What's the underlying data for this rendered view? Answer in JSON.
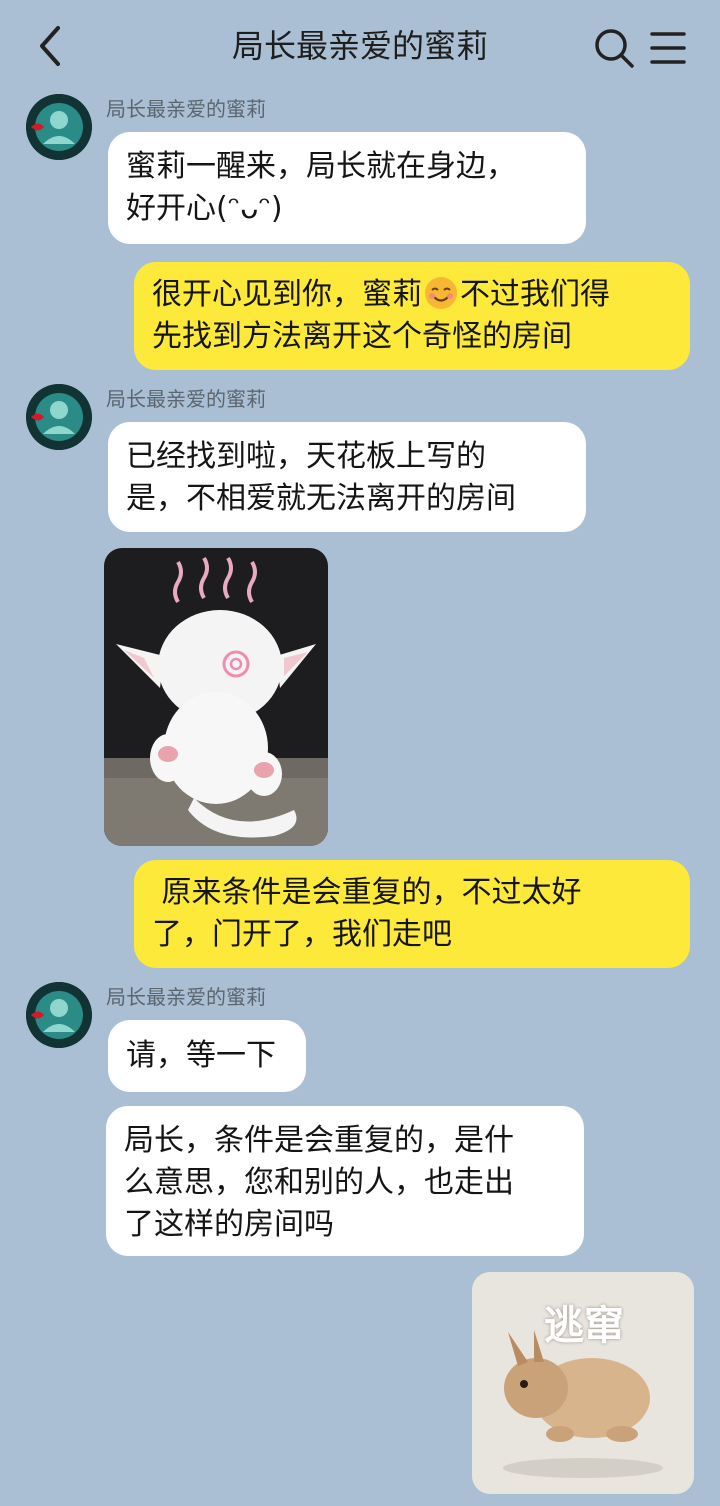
{
  "header": {
    "title": "局长最亲爱的蜜莉",
    "back_icon": "chevron-left-icon",
    "search_icon": "search-icon",
    "menu_icon": "menu-icon"
  },
  "colors": {
    "background": "#aabfd3",
    "incoming_bubble": "#ffffff",
    "outgoing_bubble": "#fce93a"
  },
  "messages": [
    {
      "direction": "in",
      "sender": "局长最亲爱的蜜莉",
      "text": "蜜莉一醒来，局长就在身边，\n好开心(ᵔᴗᵔ)"
    },
    {
      "direction": "out",
      "text_before": "很开心见到你，蜜莉",
      "emoji": "smiling-face-emoji",
      "text_after": "不过我们得\n先找到方法离开这个奇怪的房间"
    },
    {
      "direction": "in",
      "sender": "局长最亲爱的蜜莉",
      "text": "已经找到啦，天花板上写的\n是，不相爱就无法离开的房间"
    },
    {
      "direction": "in",
      "type": "image",
      "description_icon": "dizzy-cat-sticker"
    },
    {
      "direction": "out",
      "text": " 原来条件是会重复的，不过太好\n了，门开了，我们走吧"
    },
    {
      "direction": "in",
      "sender": "局长最亲爱的蜜莉",
      "text": "请，等一下"
    },
    {
      "direction": "in",
      "text": "局长，条件是会重复的，是什\n么意思，您和别的人，也走出\n了这样的房间吗"
    },
    {
      "direction": "out",
      "type": "image",
      "sticker_text": "逃窜"
    }
  ]
}
